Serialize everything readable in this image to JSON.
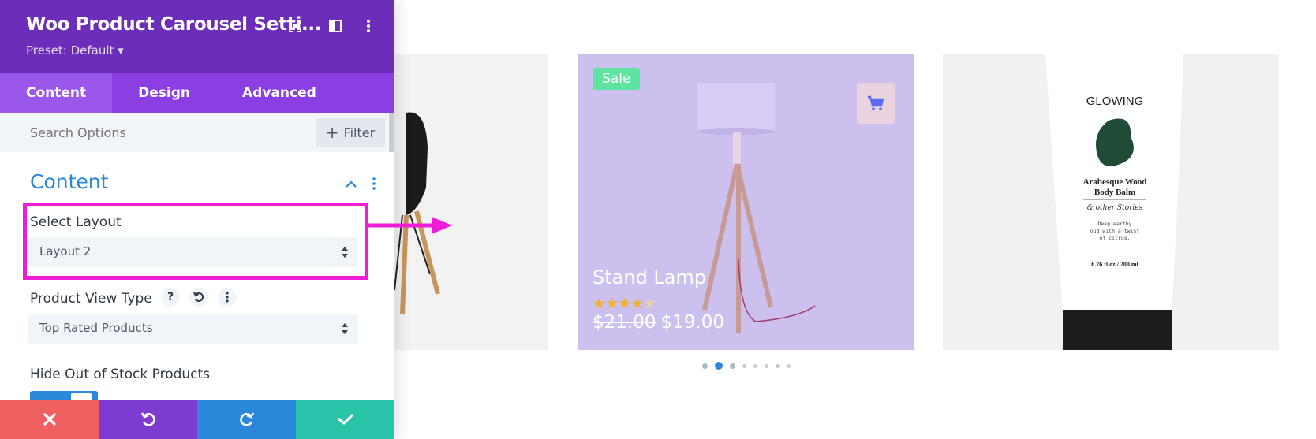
{
  "panel": {
    "title": "Woo Product Carousel Setti...",
    "preset": "Preset: Default ▾",
    "icons": [
      "fullscreen-icon",
      "split-view-icon",
      "more-options-icon"
    ]
  },
  "tabs": [
    {
      "label": "Content",
      "active": true
    },
    {
      "label": "Design",
      "active": false
    },
    {
      "label": "Advanced",
      "active": false
    }
  ],
  "search": {
    "placeholder": "Search Options",
    "filter_label": "Filter"
  },
  "section": {
    "title": "Content"
  },
  "fields": {
    "layout_label": "Select Layout",
    "layout_value": "Layout 2",
    "view_type_label": "Product View Type",
    "view_type_value": "Top Rated Products",
    "view_type_help": "?",
    "hide_stock_label": "Hide Out of Stock Products"
  },
  "footer": [
    "cancel-icon",
    "undo-icon",
    "redo-icon",
    "save-icon"
  ],
  "product": {
    "badge": "Sale",
    "title": "Stand Lamp",
    "rating": 4,
    "rating_max": 5,
    "old_price": "$21.00",
    "price": "$19.00"
  },
  "side_product": {
    "brand": "GLOWING",
    "name_line1": "Arabesque Wood",
    "name_line2": "Body Balm",
    "sub_brand": "& other Stories",
    "desc_line1": "Deep earthy",
    "desc_line2": "oud with a twist",
    "desc_line3": "of citrus.",
    "volume": "6.76 fl oz / 200 ml"
  },
  "carousel": {
    "dot_count": 8,
    "active_index": 1
  },
  "colors": {
    "header": "#6c2eb9",
    "tab_bar": "#8b3fe3",
    "accent": "#2b87da",
    "highlight": "#ef1cd8",
    "sale": "#5ee3a1",
    "card": "#cbc0ee"
  }
}
